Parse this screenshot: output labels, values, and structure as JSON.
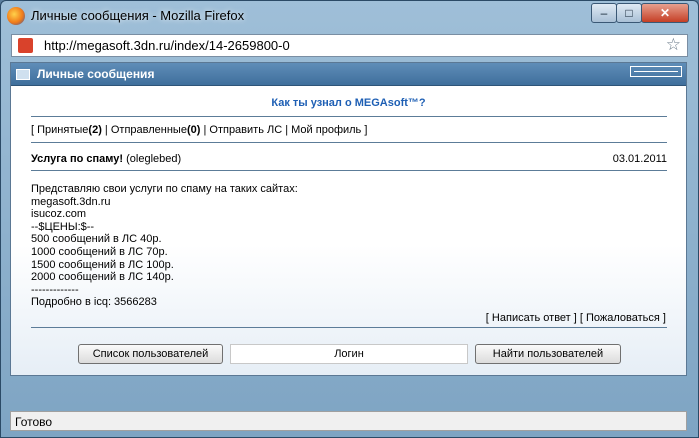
{
  "window": {
    "title": "Личные сообщения - Mozilla Firefox",
    "controls": {
      "minimize": "–",
      "maximize": "□",
      "close": "✕"
    }
  },
  "address_bar": {
    "url": "http://megasoft.3dn.ru/index/14-2659800-0"
  },
  "panel": {
    "title": "Личные сообщения"
  },
  "promo_link": "Как ты узнал о MEGAsoft™?",
  "nav": {
    "open": "[ ",
    "received_label": "Принятые",
    "received_count_open": "(",
    "received_count": "2",
    "received_count_close": ")",
    "sep1": " | ",
    "sent_label": "Отправленные",
    "sent_count_open": "(",
    "sent_count": "0",
    "sent_count_close": ")",
    "sep2": " | ",
    "send_pm": "Отправить ЛС",
    "sep3": " | ",
    "profile": "Мой профиль",
    "close": " ]"
  },
  "message": {
    "subject": "Услуга по спаму!",
    "sender": "(oleglebed)",
    "date": "03.01.2011",
    "body_lines": [
      "Представляю свои услуги по спаму на таких сайтах:",
      "megasoft.3dn.ru",
      "isucoz.com",
      "--$ЦЕНЫ:$--",
      "500 сообщений в ЛС 40р.",
      "1000 сообщений в ЛС 70р.",
      "1500 сообщений в ЛС 100р.",
      "2000 сообщений в ЛС 140р.",
      "-------------",
      "Подробно в icq: 3566283"
    ],
    "reply_open": "[ ",
    "reply": "Написать ответ",
    "reply_close": " ]",
    "report_open": " [ ",
    "report": "Пожаловаться",
    "report_close": " ]"
  },
  "bottom": {
    "users_list_button": "Список пользователей",
    "login_input_value": "Логин",
    "find_user_button": "Найти пользователей"
  },
  "status_bar": {
    "text": "Готово"
  }
}
